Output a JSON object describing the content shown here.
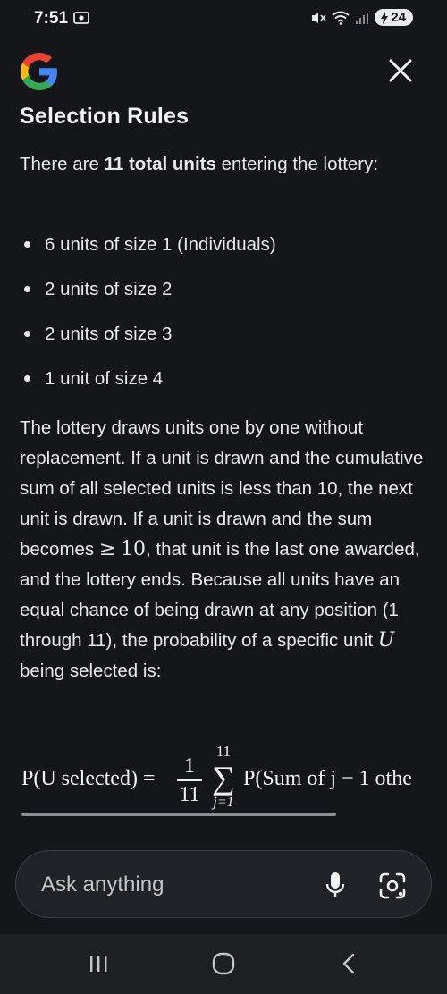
{
  "status_bar": {
    "time": "7:51",
    "battery": "24"
  },
  "header": {
    "logo": "google-g-logo",
    "close_icon": "close-icon"
  },
  "article": {
    "heading": "Selection Rules",
    "intro_prefix": "There are ",
    "intro_bold": "11 total units",
    "intro_suffix": " entering the lottery:",
    "bullets": [
      "6 units of size 1 (Individuals)",
      "2 units of size 2",
      "2 units of size 3",
      "1 unit of size 4"
    ],
    "para_1": "The lottery draws units one by one without replacement. If a unit is drawn and the cumulative sum of all selected units is less than 10, the next unit is drawn. If a unit is drawn and the sum becomes ",
    "para_ge": "≥",
    "para_ten": "10",
    "para_2": ", that unit is the last one awarded, and the lottery ends. Because all units have an equal chance of being drawn at any position (1 through 11), the probability of a specific unit ",
    "para_u": "U",
    "para_3": " being selected is:",
    "formula": {
      "lhs": "P(U selected) =",
      "frac_num": "1",
      "frac_den": "11",
      "sum_upper": "11",
      "sum_sigma": "∑",
      "sum_lower": "j=1",
      "rhs": "P(Sum of j − 1 othe"
    }
  },
  "ask_bar": {
    "placeholder": "Ask anything",
    "mic_icon": "microphone-icon",
    "lens_icon": "camera-lens-icon"
  },
  "nav_bar": {
    "recents_icon": "recents-icon",
    "home_icon": "home-icon",
    "back_icon": "back-icon"
  }
}
